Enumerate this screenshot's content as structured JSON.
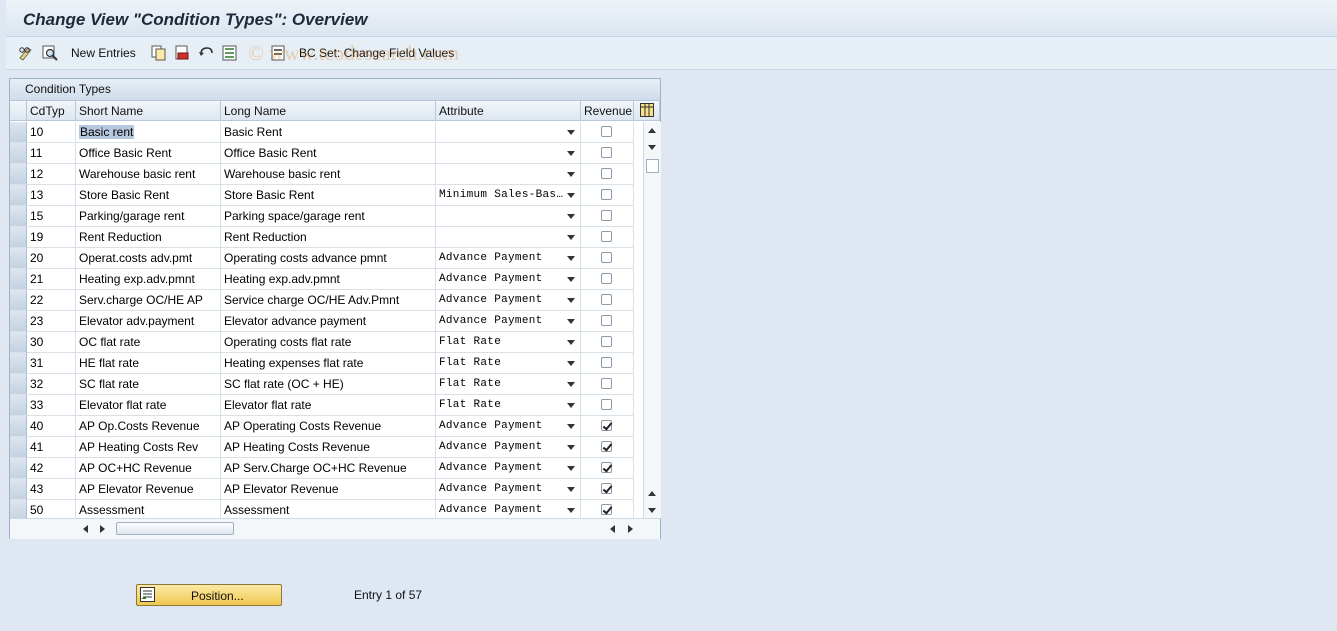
{
  "window": {
    "title": "Change View \"Condition Types\": Overview"
  },
  "toolbar": {
    "new_entries": "New Entries",
    "bc_set": "BC Set: Change Field Values",
    "icons": [
      "glasses-edit-icon",
      "find-icon",
      "copy-icon",
      "delete-icon",
      "undo-icon",
      "select-block-icon",
      "bc-set-icon"
    ]
  },
  "watermark": "© www.tcodesearch.com",
  "table": {
    "title": "Condition Types",
    "columns": [
      "CdTyp",
      "Short Name",
      "Long Name",
      "Attribute",
      "Revenue"
    ],
    "rows": [
      {
        "code": "10",
        "short": "Basic rent",
        "long": "Basic Rent",
        "attr": "",
        "revenue": false
      },
      {
        "code": "11",
        "short": "Office Basic Rent",
        "long": "Office Basic Rent",
        "attr": "",
        "revenue": false
      },
      {
        "code": "12",
        "short": "Warehouse basic rent",
        "long": "Warehouse basic rent",
        "attr": "",
        "revenue": false
      },
      {
        "code": "13",
        "short": "Store Basic Rent",
        "long": "Store Basic Rent",
        "attr": "Minimum Sales-Bas…",
        "revenue": false
      },
      {
        "code": "15",
        "short": "Parking/garage rent",
        "long": "Parking space/garage rent",
        "attr": "",
        "revenue": false
      },
      {
        "code": "19",
        "short": "Rent Reduction",
        "long": "Rent Reduction",
        "attr": "",
        "revenue": false
      },
      {
        "code": "20",
        "short": "Operat.costs adv.pmt",
        "long": "Operating costs advance pmnt",
        "attr": "Advance Payment",
        "revenue": false
      },
      {
        "code": "21",
        "short": "Heating exp.adv.pmnt",
        "long": "Heating exp.adv.pmnt",
        "attr": "Advance Payment",
        "revenue": false
      },
      {
        "code": "22",
        "short": "Serv.charge OC/HE AP",
        "long": "Service charge OC/HE Adv.Pmnt",
        "attr": "Advance Payment",
        "revenue": false
      },
      {
        "code": "23",
        "short": "Elevator adv.payment",
        "long": "Elevator advance payment",
        "attr": "Advance Payment",
        "revenue": false
      },
      {
        "code": "30",
        "short": "OC flat rate",
        "long": "Operating costs flat rate",
        "attr": "Flat Rate",
        "revenue": false
      },
      {
        "code": "31",
        "short": "HE flat rate",
        "long": "Heating expenses flat rate",
        "attr": "Flat Rate",
        "revenue": false
      },
      {
        "code": "32",
        "short": "SC flat rate",
        "long": "SC flat rate (OC + HE)",
        "attr": "Flat Rate",
        "revenue": false
      },
      {
        "code": "33",
        "short": "Elevator flat rate",
        "long": "Elevator flat rate",
        "attr": "Flat Rate",
        "revenue": false
      },
      {
        "code": "40",
        "short": "AP Op.Costs Revenue",
        "long": "AP Operating Costs Revenue",
        "attr": "Advance Payment",
        "revenue": true
      },
      {
        "code": "41",
        "short": "AP Heating Costs Rev",
        "long": "AP Heating Costs Revenue",
        "attr": "Advance Payment",
        "revenue": true
      },
      {
        "code": "42",
        "short": "AP OC+HC Revenue",
        "long": "AP Serv.Charge OC+HC Revenue",
        "attr": "Advance Payment",
        "revenue": true
      },
      {
        "code": "43",
        "short": "AP Elevator Revenue",
        "long": "AP Elevator Revenue",
        "attr": "Advance Payment",
        "revenue": true
      },
      {
        "code": "50",
        "short": "Assessment",
        "long": "Assessment",
        "attr": "Advance Payment",
        "revenue": true
      }
    ]
  },
  "footer": {
    "position_button": "Position...",
    "entry_text": "Entry 1 of 57"
  },
  "colors": {
    "background": "#dfe8f2",
    "button": "#f0c850",
    "selection_highlight": "#b6c8e0"
  }
}
